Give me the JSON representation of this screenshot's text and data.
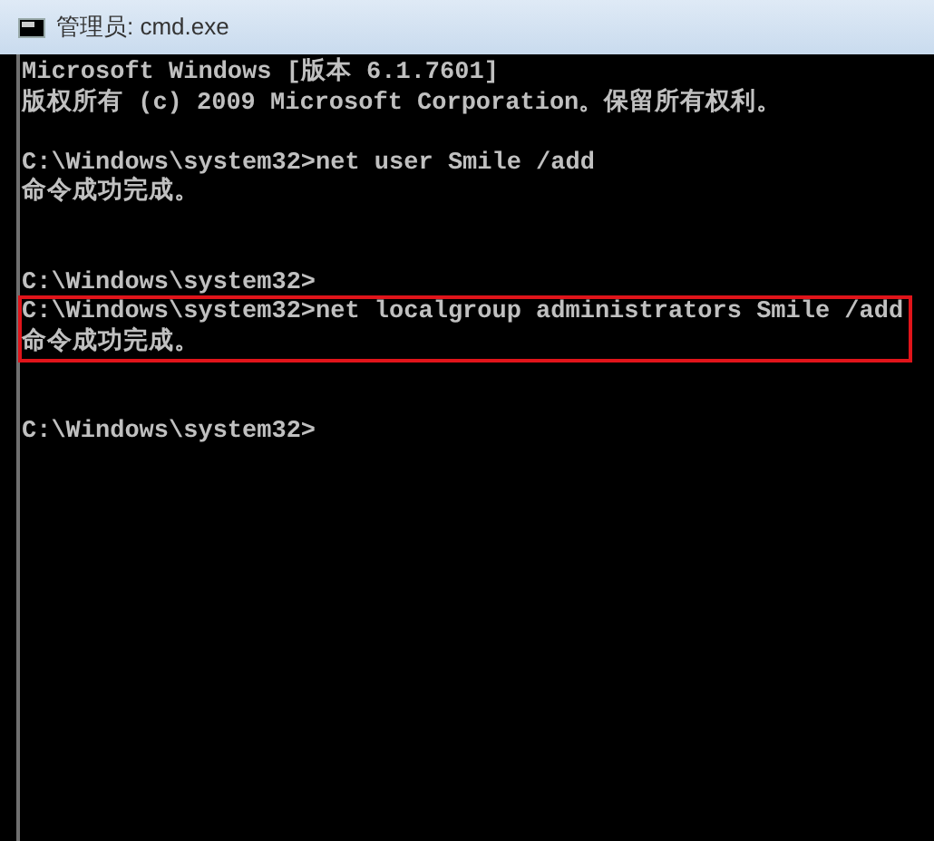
{
  "window": {
    "title": "管理员: cmd.exe"
  },
  "console": {
    "blocks": [
      {
        "kind": "line",
        "text": "Microsoft Windows [版本 6.1.7601]"
      },
      {
        "kind": "line",
        "text": "版权所有 (c) 2009 Microsoft Corporation。保留所有权利。"
      },
      {
        "kind": "blank"
      },
      {
        "kind": "line",
        "text": "C:\\Windows\\system32>net user Smile /add"
      },
      {
        "kind": "line",
        "text": "命令成功完成。"
      },
      {
        "kind": "blank"
      },
      {
        "kind": "blank"
      },
      {
        "kind": "line",
        "text": "C:\\Windows\\system32>"
      },
      {
        "kind": "highlight",
        "lines": [
          "C:\\Windows\\system32>net localgroup administrators Smile /add",
          "命令成功完成。"
        ]
      },
      {
        "kind": "blank"
      },
      {
        "kind": "blank"
      },
      {
        "kind": "line",
        "text": "C:\\Windows\\system32>"
      }
    ]
  }
}
